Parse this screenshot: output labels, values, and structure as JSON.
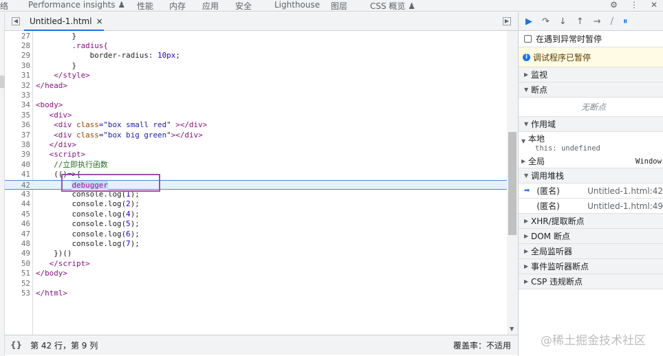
{
  "top_tabs": [
    "络",
    "Performance insights ♟",
    "性能",
    "内存",
    "应用",
    "安全",
    "Lighthouse",
    "图层",
    "CSS 概览 ♟"
  ],
  "top_icons": [
    "gear-icon",
    "more-icon",
    "close-icon"
  ],
  "file_tab": {
    "name": "Untitled-1.html",
    "close": "×"
  },
  "editor": {
    "lines": [
      {
        "n": "27",
        "t": [
          [
            "        }",
            "txt"
          ]
        ]
      },
      {
        "n": "28",
        "t": [
          [
            "        ",
            "txt"
          ],
          [
            ".radius{",
            "key"
          ]
        ]
      },
      {
        "n": "29",
        "t": [
          [
            "            border-radius: ",
            "txt"
          ],
          [
            "10px",
            "num"
          ],
          [
            ";",
            "txt"
          ]
        ]
      },
      {
        "n": "30",
        "t": [
          [
            "        }",
            "txt"
          ]
        ]
      },
      {
        "n": "31",
        "t": [
          [
            "    </style>",
            "tag"
          ]
        ]
      },
      {
        "n": "32",
        "t": [
          [
            "</head>",
            "tag"
          ]
        ]
      },
      {
        "n": "33",
        "t": []
      },
      {
        "n": "34",
        "t": [
          [
            "<body>",
            "tag"
          ]
        ]
      },
      {
        "n": "35",
        "t": [
          [
            "   <div>",
            "tag"
          ]
        ]
      },
      {
        "n": "36",
        "t": [
          [
            "    <div ",
            "tag"
          ],
          [
            "class",
            "attr"
          ],
          [
            "=\"box small red\" ",
            "str"
          ],
          [
            "></div>",
            "tag"
          ]
        ]
      },
      {
        "n": "37",
        "t": [
          [
            "    <div ",
            "tag"
          ],
          [
            "class",
            "attr"
          ],
          [
            "=\"box big green\"",
            "str"
          ],
          [
            "></div>",
            "tag"
          ]
        ]
      },
      {
        "n": "38",
        "t": [
          [
            "   </div>",
            "tag"
          ]
        ]
      },
      {
        "n": "39",
        "t": [
          [
            "   <script>",
            "tag"
          ]
        ]
      },
      {
        "n": "40",
        "t": [
          [
            "    //立即执行函数",
            "com"
          ]
        ]
      },
      {
        "n": "41",
        "t": [
          [
            "    (()=>{",
            "txt"
          ]
        ]
      },
      {
        "n": "42",
        "t": [
          [
            "        ",
            "txt"
          ],
          [
            "debugger",
            "kw"
          ]
        ],
        "exec": true
      },
      {
        "n": "43",
        "t": [
          [
            "        console.log(",
            "txt"
          ],
          [
            "1",
            "num"
          ],
          [
            ");",
            "txt"
          ]
        ]
      },
      {
        "n": "44",
        "t": [
          [
            "        console.log(",
            "txt"
          ],
          [
            "2",
            "num"
          ],
          [
            ");",
            "txt"
          ]
        ]
      },
      {
        "n": "45",
        "t": [
          [
            "        console.log(",
            "txt"
          ],
          [
            "4",
            "num"
          ],
          [
            ");",
            "txt"
          ]
        ]
      },
      {
        "n": "46",
        "t": [
          [
            "        console.log(",
            "txt"
          ],
          [
            "5",
            "num"
          ],
          [
            ");",
            "txt"
          ]
        ]
      },
      {
        "n": "47",
        "t": [
          [
            "        console.log(",
            "txt"
          ],
          [
            "6",
            "num"
          ],
          [
            ");",
            "txt"
          ]
        ]
      },
      {
        "n": "48",
        "t": [
          [
            "        console.log(",
            "txt"
          ],
          [
            "7",
            "num"
          ],
          [
            ");",
            "txt"
          ]
        ]
      },
      {
        "n": "49",
        "t": [
          [
            "    })()",
            "txt"
          ]
        ]
      },
      {
        "n": "50",
        "t": [
          [
            "   </script>",
            "tag"
          ]
        ]
      },
      {
        "n": "51",
        "t": [
          [
            "</body>",
            "tag"
          ]
        ]
      },
      {
        "n": "52",
        "t": []
      },
      {
        "n": "53",
        "t": [
          [
            "</html>",
            "tag"
          ]
        ]
      }
    ]
  },
  "status": {
    "braces": "{}",
    "position": "第 42 行，第 9 列",
    "coverage": "覆盖率：不适用"
  },
  "debugger": {
    "pause_on_exceptions": "在遇到异常时暂停",
    "paused_msg": "调试程序已暂停",
    "watch": "监视",
    "breakpoints": "断点",
    "no_breakpoints": "无断点",
    "scope": "作用域",
    "local": "本地",
    "this_key": "this: ",
    "this_val": "undefined",
    "global": "全局",
    "global_val": "Window",
    "callstack": "调用堆栈",
    "frames": [
      {
        "name": "(匿名)",
        "loc": "Untitled-1.html:42"
      },
      {
        "name": "(匿名)",
        "loc": "Untitled-1.html:49"
      }
    ],
    "xhr": "XHR/提取断点",
    "dom": "DOM 断点",
    "global_listeners": "全局监听器",
    "event_listeners": "事件监听器断点",
    "csp": "CSP 违规断点"
  },
  "watermark": "@稀土掘金技术社区"
}
